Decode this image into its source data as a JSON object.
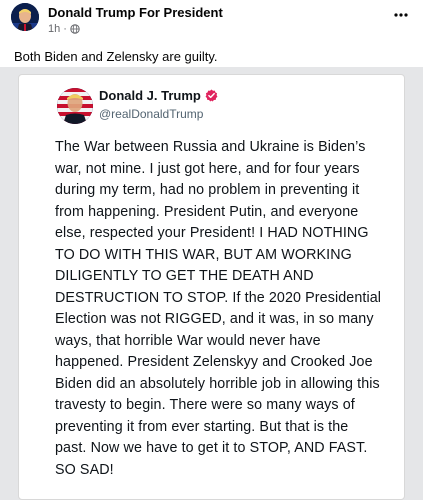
{
  "post": {
    "page_name": "Donald Trump For President",
    "time": "1h",
    "dot": "·",
    "caption": "Both Biden and Zelensky are guilty."
  },
  "shared": {
    "name": "Donald J. Trump",
    "handle": "@realDonaldTrump",
    "lines": [
      "The War between Russia and Ukraine is Biden’s",
      "war, not mine. I just got here, and for four years",
      "during my term, had no problem in preventing it",
      "from happening. President Putin, and everyone",
      "else, respected your President! I HAD NOTHING",
      "TO DO WITH THIS WAR, BUT AM WORKING",
      "DILIGENTLY TO GET THE DEATH AND",
      "DESTRUCTION TO STOP. If the 2020 Presidential",
      "Election was not RIGGED, and it was, in so many",
      "ways, that horrible War would never have",
      "happened. President Zelenskyy and Crooked Joe",
      "Biden did an absolutely horrible job in allowing this",
      "travesty to begin. There were so many ways of",
      "preventing it from ever starting. But that is the",
      "past. Now we have to get it to STOP, AND FAST.",
      "SO SAD!"
    ]
  },
  "icons": {
    "more": "more-options-icon",
    "globe": "globe-icon",
    "verified": "verified-badge-icon"
  },
  "colors": {
    "meta_gray": "#65676b",
    "handle_gray": "#536471",
    "verified_pink": "#e0245e",
    "frame_gray": "#e5e6e8"
  }
}
